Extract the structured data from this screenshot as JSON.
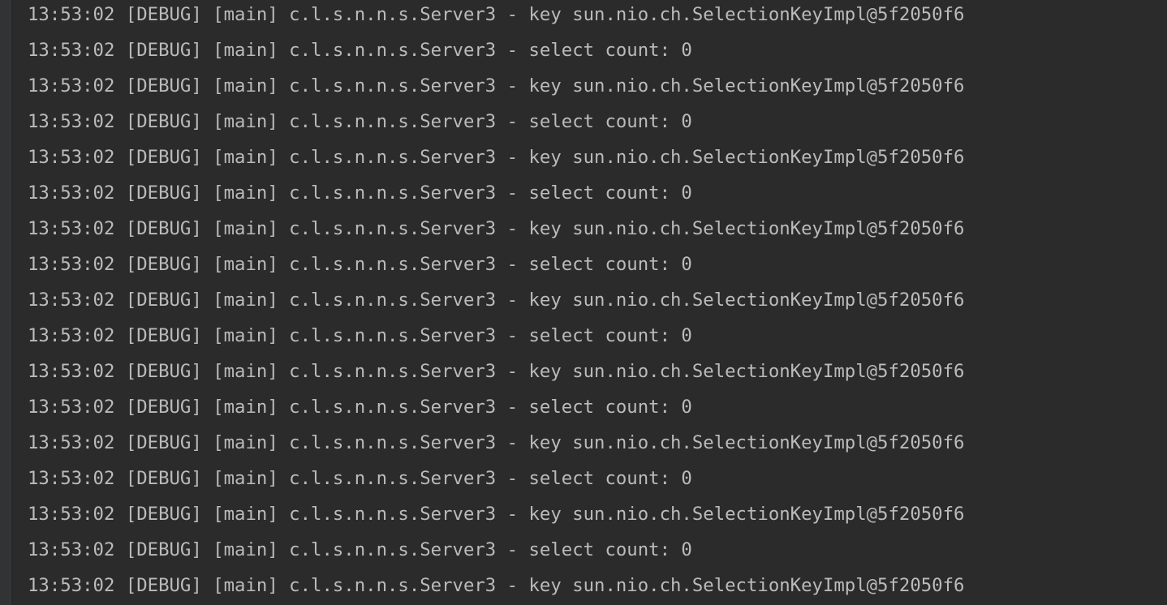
{
  "console": {
    "lines": [
      "13:53:02 [DEBUG] [main] c.l.s.n.n.s.Server3 - key sun.nio.ch.SelectionKeyImpl@5f2050f6",
      "13:53:02 [DEBUG] [main] c.l.s.n.n.s.Server3 - select count: 0",
      "13:53:02 [DEBUG] [main] c.l.s.n.n.s.Server3 - key sun.nio.ch.SelectionKeyImpl@5f2050f6",
      "13:53:02 [DEBUG] [main] c.l.s.n.n.s.Server3 - select count: 0",
      "13:53:02 [DEBUG] [main] c.l.s.n.n.s.Server3 - key sun.nio.ch.SelectionKeyImpl@5f2050f6",
      "13:53:02 [DEBUG] [main] c.l.s.n.n.s.Server3 - select count: 0",
      "13:53:02 [DEBUG] [main] c.l.s.n.n.s.Server3 - key sun.nio.ch.SelectionKeyImpl@5f2050f6",
      "13:53:02 [DEBUG] [main] c.l.s.n.n.s.Server3 - select count: 0",
      "13:53:02 [DEBUG] [main] c.l.s.n.n.s.Server3 - key sun.nio.ch.SelectionKeyImpl@5f2050f6",
      "13:53:02 [DEBUG] [main] c.l.s.n.n.s.Server3 - select count: 0",
      "13:53:02 [DEBUG] [main] c.l.s.n.n.s.Server3 - key sun.nio.ch.SelectionKeyImpl@5f2050f6",
      "13:53:02 [DEBUG] [main] c.l.s.n.n.s.Server3 - select count: 0",
      "13:53:02 [DEBUG] [main] c.l.s.n.n.s.Server3 - key sun.nio.ch.SelectionKeyImpl@5f2050f6",
      "13:53:02 [DEBUG] [main] c.l.s.n.n.s.Server3 - select count: 0",
      "13:53:02 [DEBUG] [main] c.l.s.n.n.s.Server3 - key sun.nio.ch.SelectionKeyImpl@5f2050f6",
      "13:53:02 [DEBUG] [main] c.l.s.n.n.s.Server3 - select count: 0",
      "13:53:02 [DEBUG] [main] c.l.s.n.n.s.Server3 - key sun.nio.ch.SelectionKeyImpl@5f2050f6"
    ]
  },
  "colors": {
    "background": "#2b2b2b",
    "text": "#bbbbbb",
    "gutter": "#313335"
  }
}
